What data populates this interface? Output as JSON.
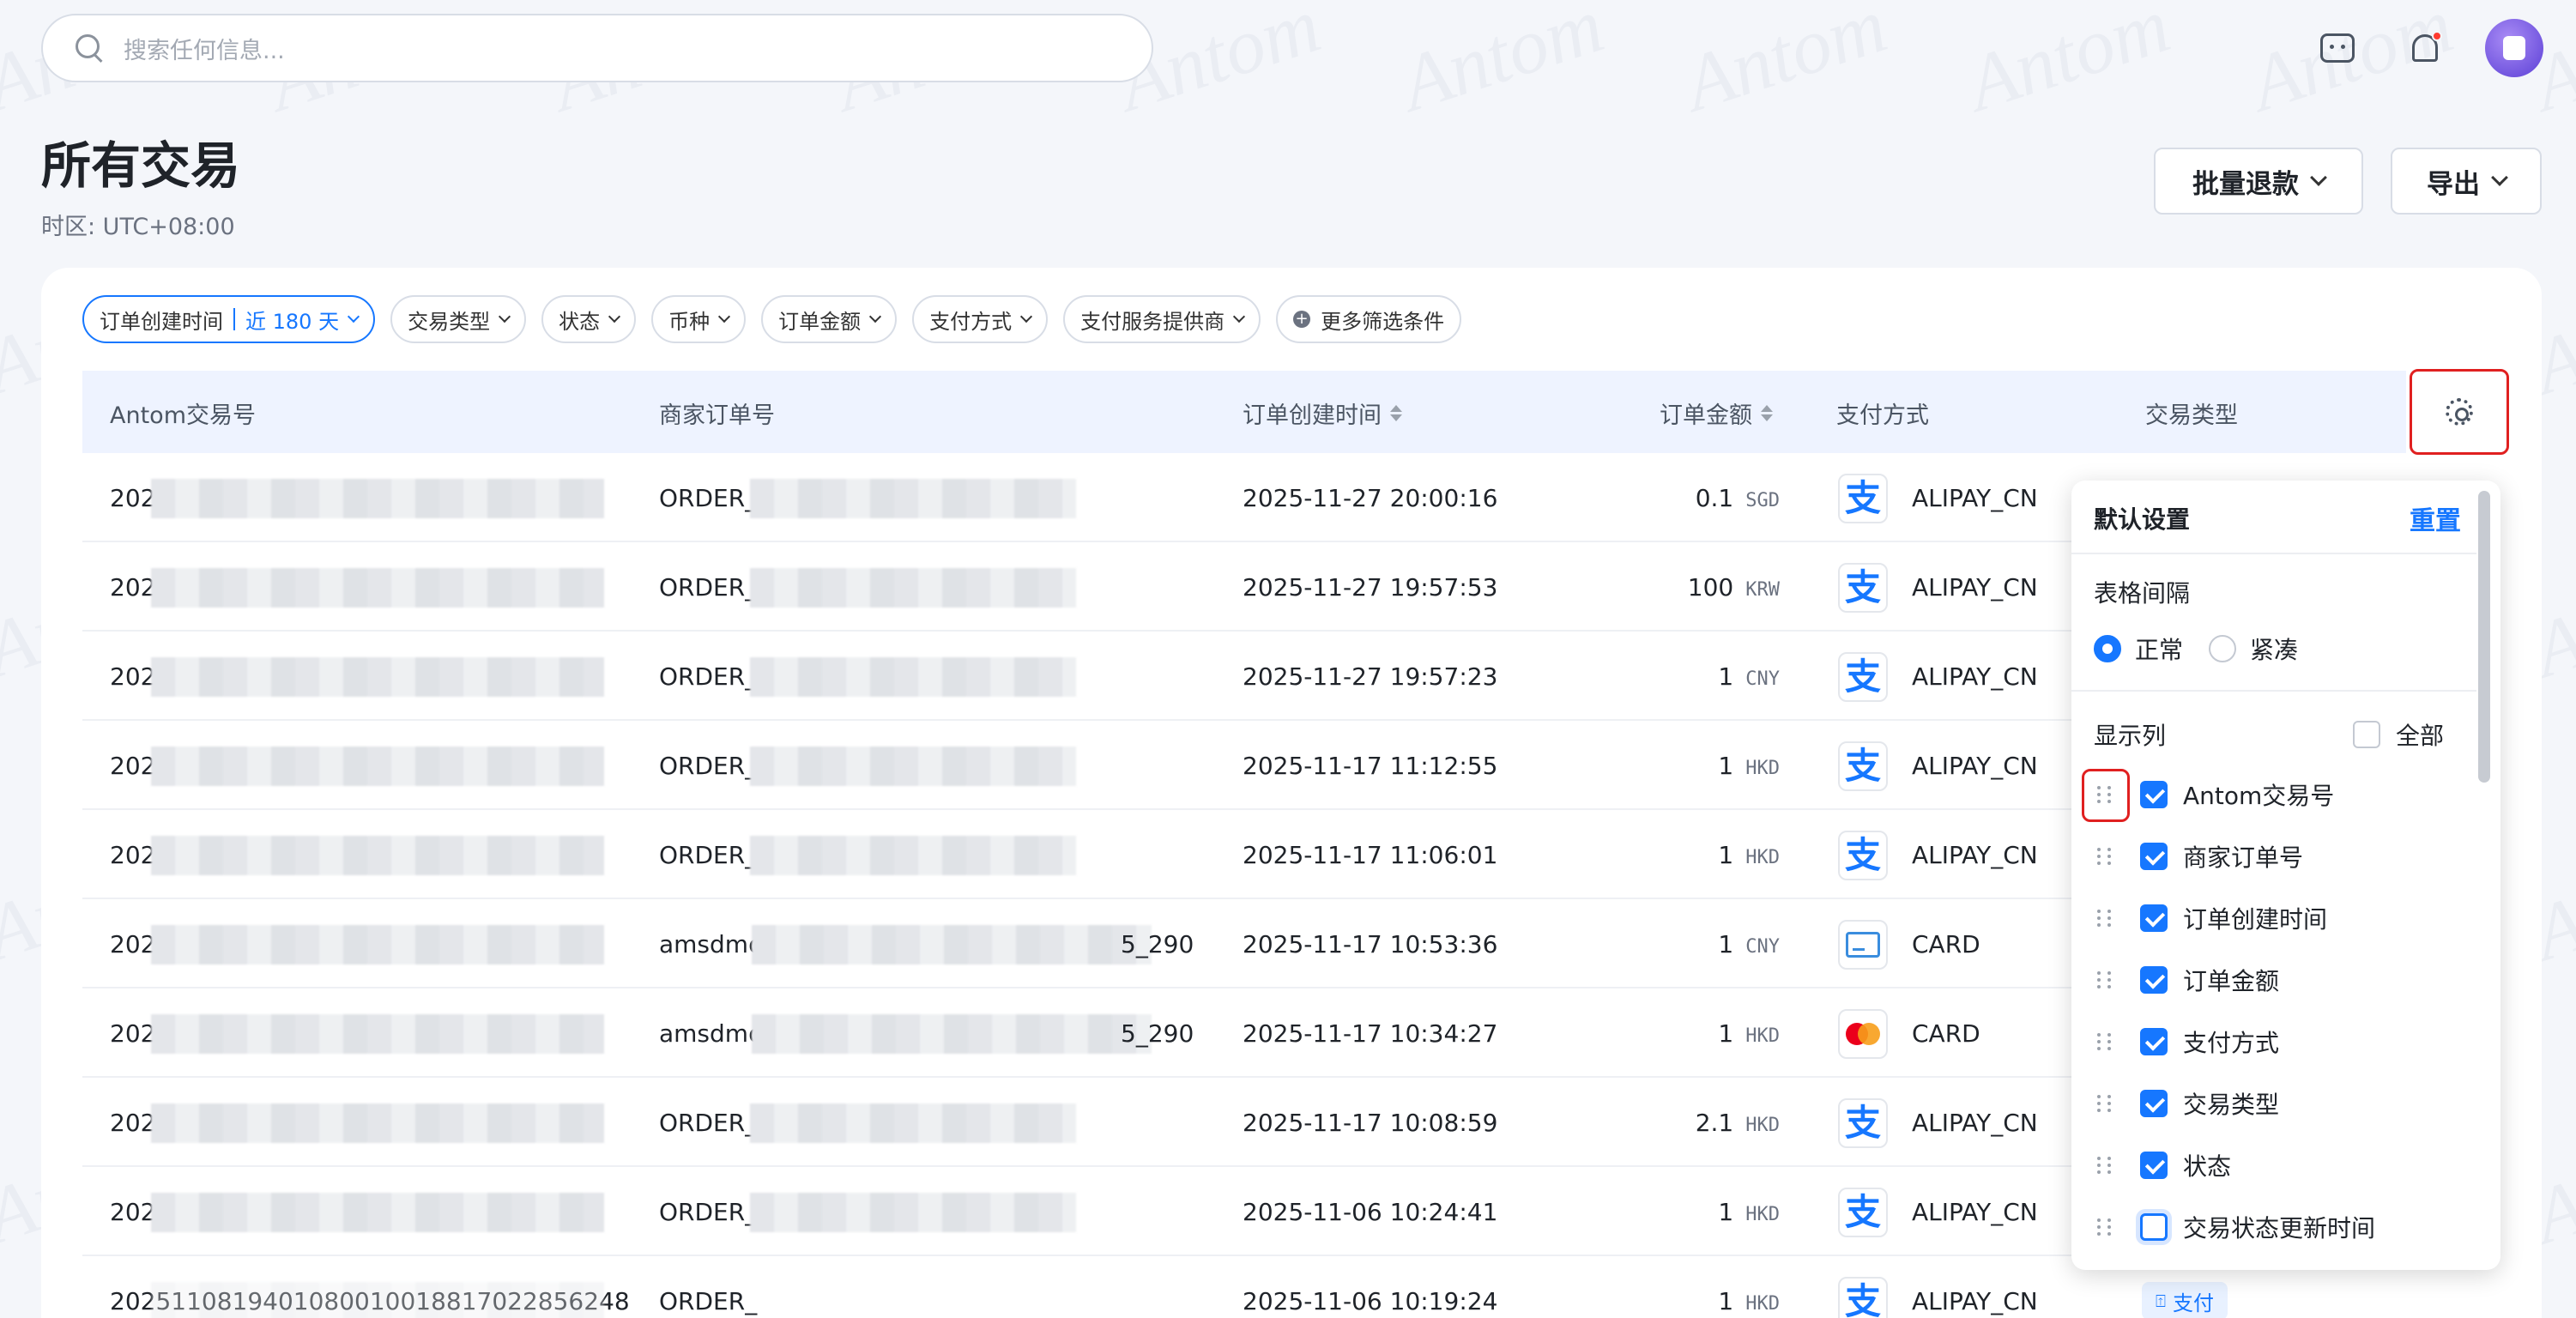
{
  "search": {
    "placeholder": "搜索任何信息..."
  },
  "header": {
    "title": "所有交易",
    "timezone": "时区: UTC+08:00",
    "refund_label": "批量退款",
    "export_label": "导出"
  },
  "filters": {
    "created_label": "订单创建时间",
    "created_value": "近 180 天",
    "items": [
      "交易类型",
      "状态",
      "币种",
      "订单金额",
      "支付方式",
      "支付服务提供商"
    ],
    "more_label": "更多筛选条件"
  },
  "columns": {
    "txn_id": "Antom交易号",
    "merchant_order": "商家订单号",
    "created": "订单创建时间",
    "amount": "订单金额",
    "method": "支付方式",
    "type": "交易类型"
  },
  "rows": [
    {
      "txn_prefix": "202",
      "order_prefix": "ORDER_",
      "order_suffix": "",
      "created": "2025-11-27 20:00:16",
      "amount": "0.1",
      "currency": "SGD",
      "method_icon": "alipay-icon",
      "method": "ALIPAY_CN"
    },
    {
      "txn_prefix": "202",
      "order_prefix": "ORDER_",
      "order_suffix": "",
      "created": "2025-11-27 19:57:53",
      "amount": "100",
      "currency": "KRW",
      "method_icon": "alipay-icon",
      "method": "ALIPAY_CN"
    },
    {
      "txn_prefix": "202",
      "order_prefix": "ORDER_",
      "order_suffix": "",
      "created": "2025-11-27 19:57:23",
      "amount": "1",
      "currency": "CNY",
      "method_icon": "alipay-icon",
      "method": "ALIPAY_CN"
    },
    {
      "txn_prefix": "202",
      "order_prefix": "ORDER_",
      "order_suffix": "",
      "created": "2025-11-17 11:12:55",
      "amount": "1",
      "currency": "HKD",
      "method_icon": "alipay-icon",
      "method": "ALIPAY_CN"
    },
    {
      "txn_prefix": "202",
      "order_prefix": "ORDER_",
      "order_suffix": "",
      "created": "2025-11-17 11:06:01",
      "amount": "1",
      "currency": "HKD",
      "method_icon": "alipay-icon",
      "method": "ALIPAY_CN"
    },
    {
      "txn_prefix": "202",
      "order_prefix": "amsdmo",
      "order_suffix": "5_290",
      "created": "2025-11-17 10:53:36",
      "amount": "1",
      "currency": "CNY",
      "method_icon": "card-icon",
      "method": "CARD"
    },
    {
      "txn_prefix": "202",
      "order_prefix": "amsdmo",
      "order_suffix": "5_290",
      "created": "2025-11-17 10:34:27",
      "amount": "1",
      "currency": "HKD",
      "method_icon": "mastercard-icon",
      "method": "CARD"
    },
    {
      "txn_prefix": "202",
      "order_prefix": "ORDER_",
      "order_suffix": "",
      "created": "2025-11-17 10:08:59",
      "amount": "2.1",
      "currency": "HKD",
      "method_icon": "alipay-icon",
      "method": "ALIPAY_CN"
    },
    {
      "txn_prefix": "202",
      "order_prefix": "ORDER_",
      "order_suffix": "",
      "created": "2025-11-06 10:24:41",
      "amount": "1",
      "currency": "HKD",
      "method_icon": "alipay-icon",
      "method": "ALIPAY_CN"
    },
    {
      "txn_prefix": "2025110819401080010018817022856248",
      "order_prefix": "ORDER_",
      "order_suffix": "",
      "created": "2025-11-06 10:19:24",
      "amount": "1",
      "currency": "HKD",
      "method_icon": "alipay-icon",
      "method": "ALIPAY_CN",
      "type_badge": "支付"
    }
  ],
  "settings_panel": {
    "title": "默认设置",
    "reset_label": "重置",
    "spacing_label": "表格间隔",
    "spacing_options": [
      {
        "label": "正常",
        "selected": true
      },
      {
        "label": "紧凑",
        "selected": false
      }
    ],
    "columns_label": "显示列",
    "all_label": "全部",
    "column_items": [
      {
        "label": "Antom交易号",
        "checked": true
      },
      {
        "label": "商家订单号",
        "checked": true
      },
      {
        "label": "订单创建时间",
        "checked": true
      },
      {
        "label": "订单金额",
        "checked": true
      },
      {
        "label": "支付方式",
        "checked": true
      },
      {
        "label": "交易类型",
        "checked": true
      },
      {
        "label": "状态",
        "checked": true
      },
      {
        "label": "交易状态更新时间",
        "checked": false
      }
    ]
  },
  "colors": {
    "accent": "#1677ff",
    "highlight": "#e02020",
    "table_header_bg": "#eef3ff"
  }
}
